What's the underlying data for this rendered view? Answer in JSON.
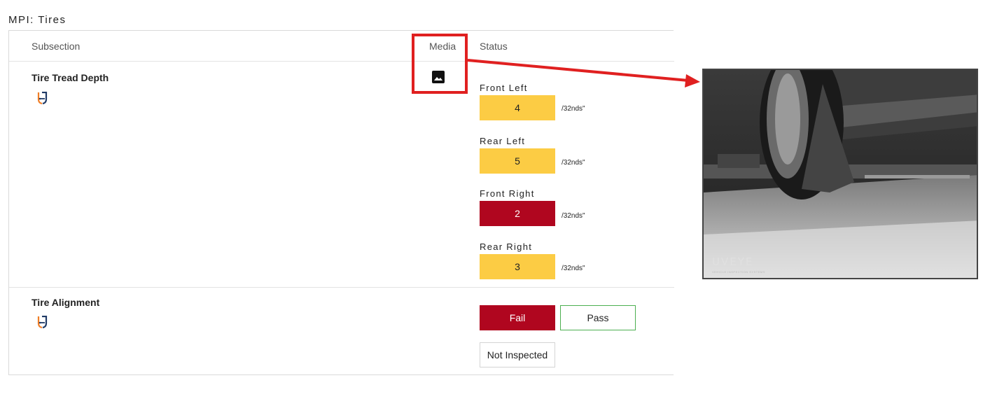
{
  "section": {
    "title": "MPI: Tires"
  },
  "table": {
    "headers": {
      "subsection": "Subsection",
      "media": "Media",
      "status": "Status"
    }
  },
  "rows": {
    "tread": {
      "title": "Tire Tread Depth",
      "measurements": [
        {
          "label": "Front Left",
          "value": "4",
          "unit": "/32nds\"",
          "color": "#fccc44"
        },
        {
          "label": "Rear Left",
          "value": "5",
          "unit": "/32nds\"",
          "color": "#fccc44"
        },
        {
          "label": "Front Right",
          "value": "2",
          "unit": "/32nds\"",
          "color": "#b0061f"
        },
        {
          "label": "Rear Right",
          "value": "3",
          "unit": "/32nds\"",
          "color": "#fccc44"
        }
      ]
    },
    "alignment": {
      "title": "Tire Alignment",
      "buttons": {
        "fail": "Fail",
        "pass": "Pass",
        "not_inspected": "Not Inspected"
      },
      "selected": "Fail"
    }
  },
  "photo": {
    "logo": "UVEYE",
    "tagline": "VEHICLE INSPECTION SYSTEMS"
  },
  "colors": {
    "warning": "#fccc44",
    "critical": "#b0061f",
    "highlight": "#e02020",
    "pass_border": "#4caf50"
  },
  "icons": {
    "media": "image-icon",
    "brand": "uveye-brand-icon"
  }
}
